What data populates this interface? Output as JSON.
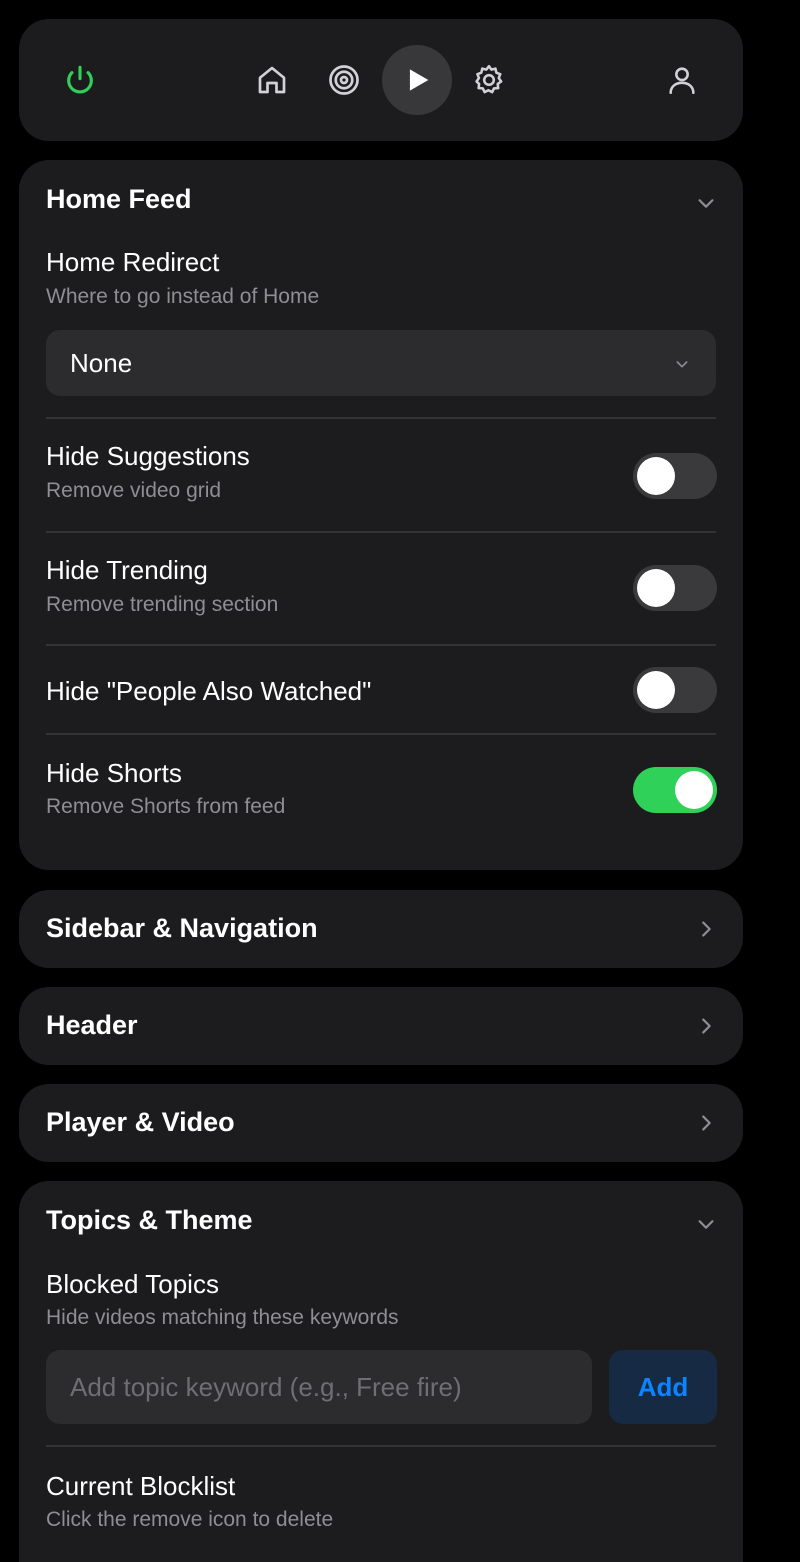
{
  "colors": {
    "background": "#000000",
    "card": "#1c1c1e",
    "power_icon": "#30d158",
    "toggle_on": "#30d158",
    "toggle_off": "#3a3a3c",
    "accent": "#0a84ff",
    "subtext": "#8e8e93"
  },
  "nav": {
    "items": [
      {
        "icon": "power-icon"
      },
      {
        "icon": "home-icon"
      },
      {
        "icon": "target-icon"
      },
      {
        "icon": "play-icon",
        "active": true
      },
      {
        "icon": "gear-icon"
      },
      {
        "icon": "user-icon"
      }
    ]
  },
  "home_feed": {
    "title": "Home Feed",
    "expanded": true,
    "redirect": {
      "title": "Home Redirect",
      "subtitle": "Where to go instead of Home",
      "selected": "None"
    },
    "toggles": [
      {
        "title": "Hide Suggestions",
        "subtitle": "Remove video grid",
        "on": false
      },
      {
        "title": "Hide Trending",
        "subtitle": "Remove trending section",
        "on": false
      },
      {
        "title": "Hide \"People Also Watched\"",
        "subtitle": "",
        "on": false
      },
      {
        "title": "Hide Shorts",
        "subtitle": "Remove Shorts from feed",
        "on": true
      }
    ]
  },
  "sections": [
    {
      "title": "Sidebar & Navigation",
      "expanded": false
    },
    {
      "title": "Header",
      "expanded": false
    },
    {
      "title": "Player & Video",
      "expanded": false
    }
  ],
  "topics": {
    "title": "Topics & Theme",
    "expanded": true,
    "blocked": {
      "title": "Blocked Topics",
      "subtitle": "Hide videos matching these keywords",
      "placeholder": "Add topic keyword (e.g., Free fire)",
      "value": "",
      "add_label": "Add"
    },
    "blocklist": {
      "title": "Current Blocklist",
      "subtitle": "Click the remove icon to delete"
    }
  }
}
